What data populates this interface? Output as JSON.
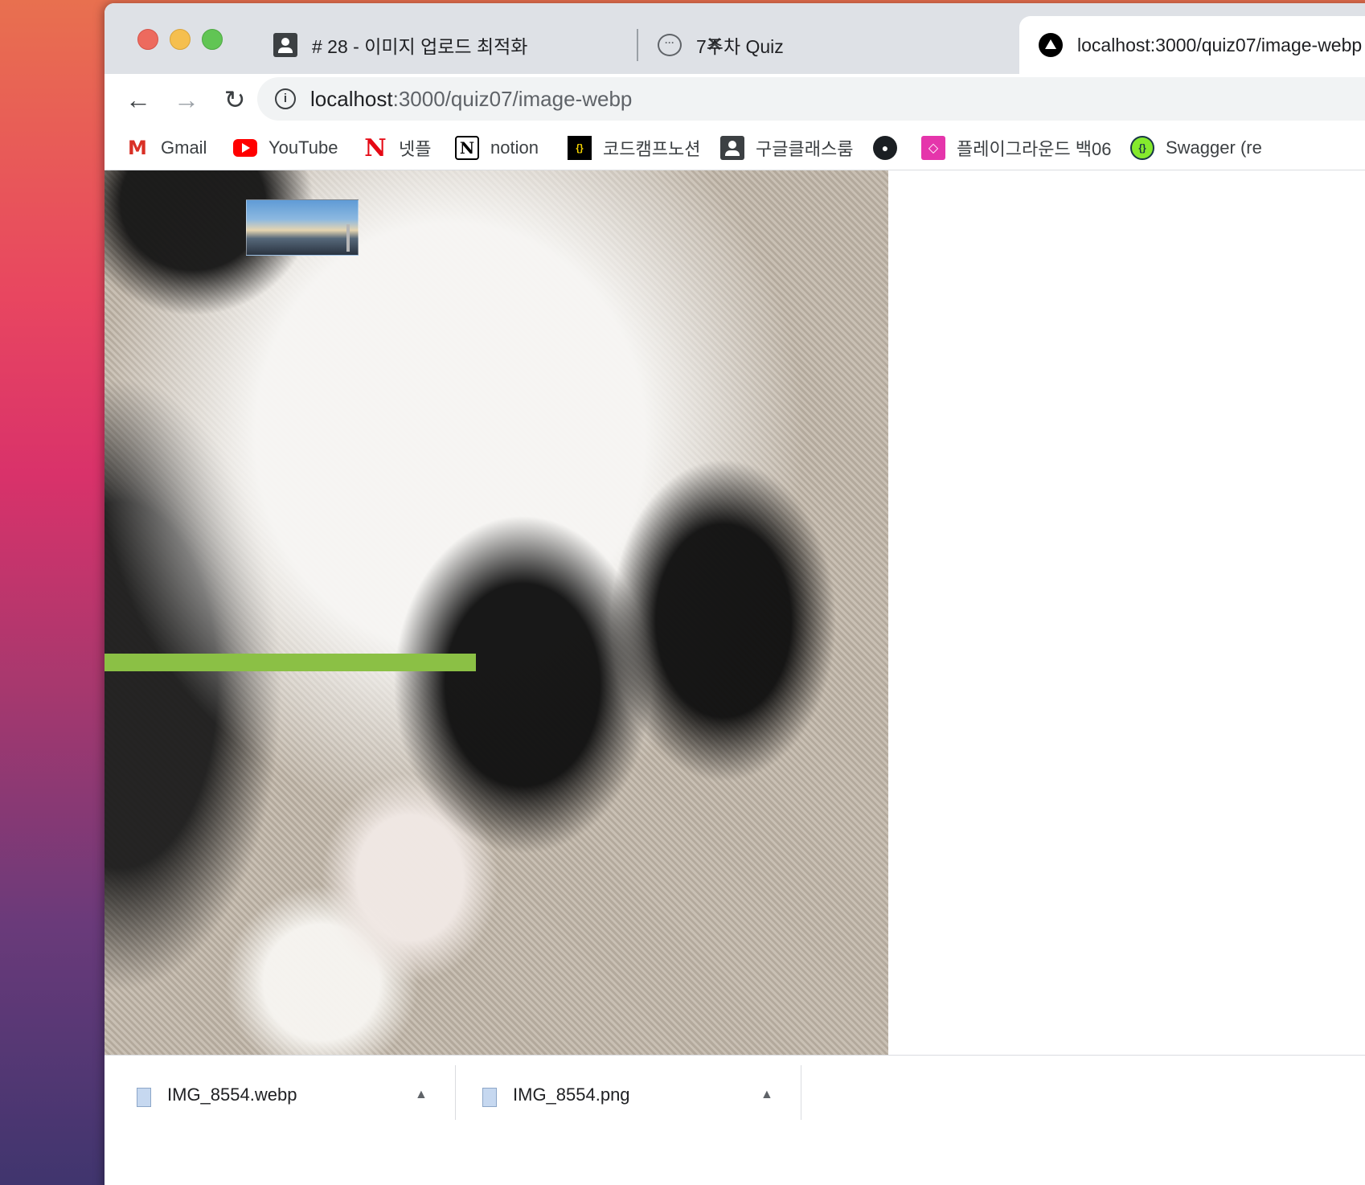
{
  "browser": {
    "tabs": [
      {
        "title": "# 28 - 이미지 업로드 최적화",
        "icon": "classroom-icon",
        "active": false
      },
      {
        "title": "7주차 Quiz",
        "icon": "chat-icon",
        "active": false
      },
      {
        "title": "localhost:3000/quiz07/image-webp",
        "icon": "nextjs-icon",
        "active": true
      }
    ],
    "address_bar": {
      "host": "localhost",
      "path": ":3000/quiz07/image-webp"
    },
    "bookmarks": [
      {
        "label": "Gmail",
        "icon": "gmail-icon"
      },
      {
        "label": "YouTube",
        "icon": "youtube-icon"
      },
      {
        "label": "넷플",
        "icon": "netflix-icon"
      },
      {
        "label": "notion",
        "icon": "notion-icon"
      },
      {
        "label": "코드캠프노션",
        "icon": "codecamp-icon"
      },
      {
        "label": "구글클래스룸",
        "icon": "classroom-icon"
      },
      {
        "label": "",
        "icon": "github-icon"
      },
      {
        "label": "플레이그라운드 백06",
        "icon": "graphql-icon"
      },
      {
        "label": "Swagger (re",
        "icon": "swagger-icon"
      }
    ]
  },
  "page": {
    "progress_fraction": 0.474
  },
  "downloads": [
    {
      "filename": "IMG_8554.webp"
    },
    {
      "filename": "IMG_8554.png"
    }
  ],
  "colors": {
    "progress": "#8bc045",
    "tabstrip": "#dee1e6"
  }
}
